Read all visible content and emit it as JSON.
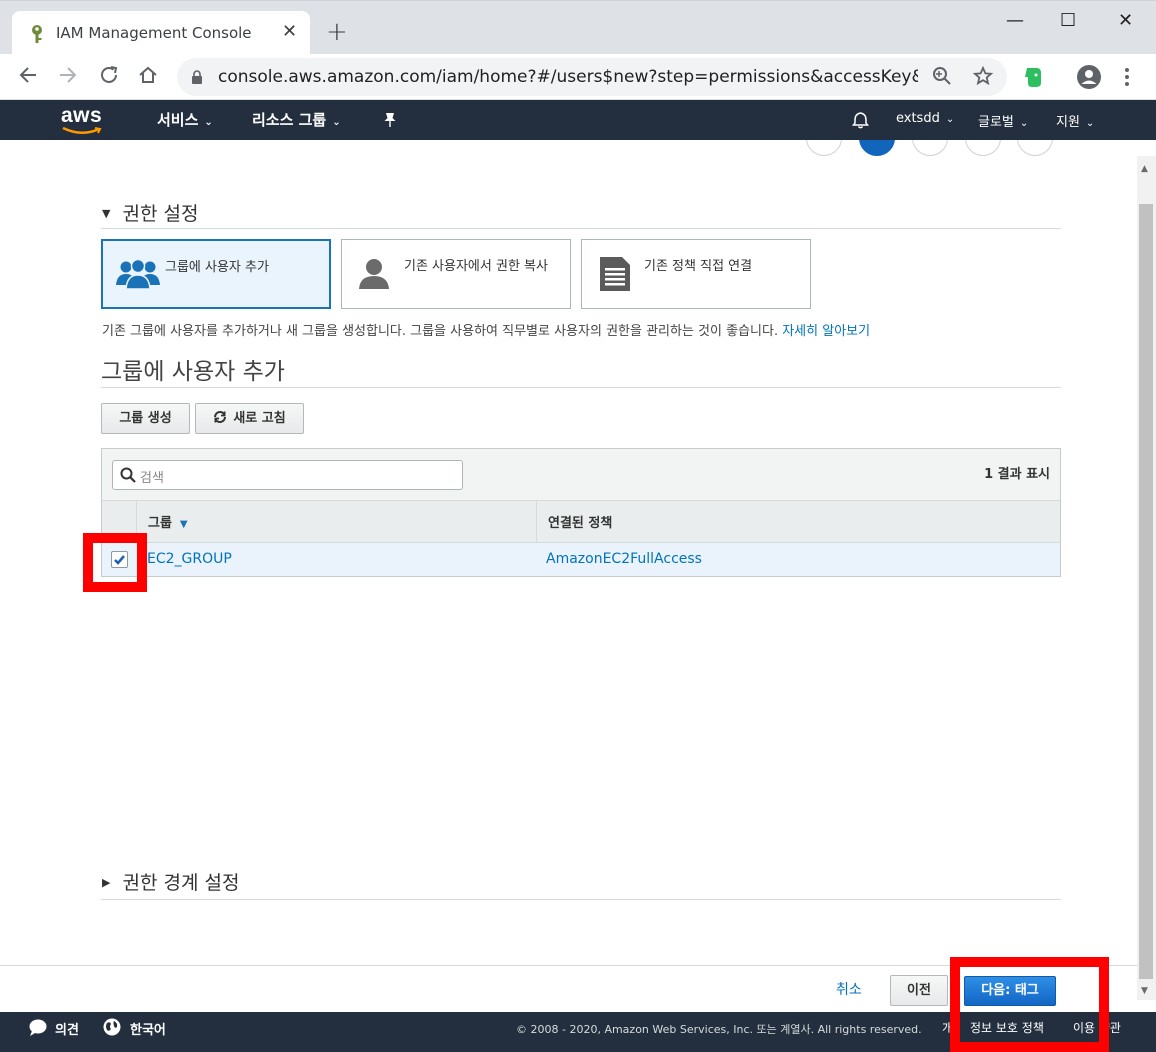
{
  "browser": {
    "tab_title": "IAM Management Console",
    "close_glyph": "✕",
    "newtab_glyph": "+",
    "url": "console.aws.amazon.com/iam/home?#/users$new?step=permissions&accessKey&user...",
    "window_minimize": "—",
    "window_maximize": "☐",
    "window_close": "✕"
  },
  "aws_header": {
    "logo": "aws",
    "nav": [
      {
        "label": "서비스"
      },
      {
        "label": "리소스 그룹"
      }
    ],
    "pin_glyph": "✦",
    "bell_glyph": "🔔",
    "account": "extsdd",
    "region": "글로벌",
    "support": "지원",
    "caret": "⌄"
  },
  "permissions": {
    "section_title": "권한 설정",
    "options": [
      {
        "label": "그룹에 사용자 추가",
        "icon": "users-group-icon",
        "selected": true
      },
      {
        "label": "기존 사용자에서 권한 복사",
        "icon": "user-icon",
        "selected": false
      },
      {
        "label": "기존 정책 직접 연결",
        "icon": "document-icon",
        "selected": false
      }
    ],
    "description": "기존 그룹에 사용자를 추가하거나 새 그룹을 생성합니다. 그룹을 사용하여 직무별로 사용자의 권한을 관리하는 것이 좋습니다.",
    "learn_more": "자세히 알아보기",
    "group_heading": "그룹에 사용자 추가",
    "create_group": "그룹 생성",
    "refresh": "새로 고침"
  },
  "table": {
    "search_placeholder": "검색",
    "result_count": "1 결과 표시",
    "columns": [
      "그룹",
      "연결된 정책"
    ],
    "rows": [
      {
        "group": "EC2_GROUP",
        "policy": "AmazonEC2FullAccess",
        "checked": true
      }
    ]
  },
  "boundary": {
    "section_title": "권한 경계 설정"
  },
  "actions": {
    "cancel": "취소",
    "previous": "이전",
    "next": "다음: 태그"
  },
  "page_footer": {
    "feedback": "의견",
    "language": "한국어",
    "copyright": "© 2008 - 2020, Amazon Web Services, Inc. 또는 계열사. All rights reserved.",
    "privacy_lead": "개",
    "privacy": "정보 보호 정책",
    "terms": "이용 약관"
  },
  "colors": {
    "aws_navy": "#232f3e",
    "link_blue": "#0073bb",
    "primary_blue": "#1366c4",
    "highlight_red": "#ff0000"
  }
}
